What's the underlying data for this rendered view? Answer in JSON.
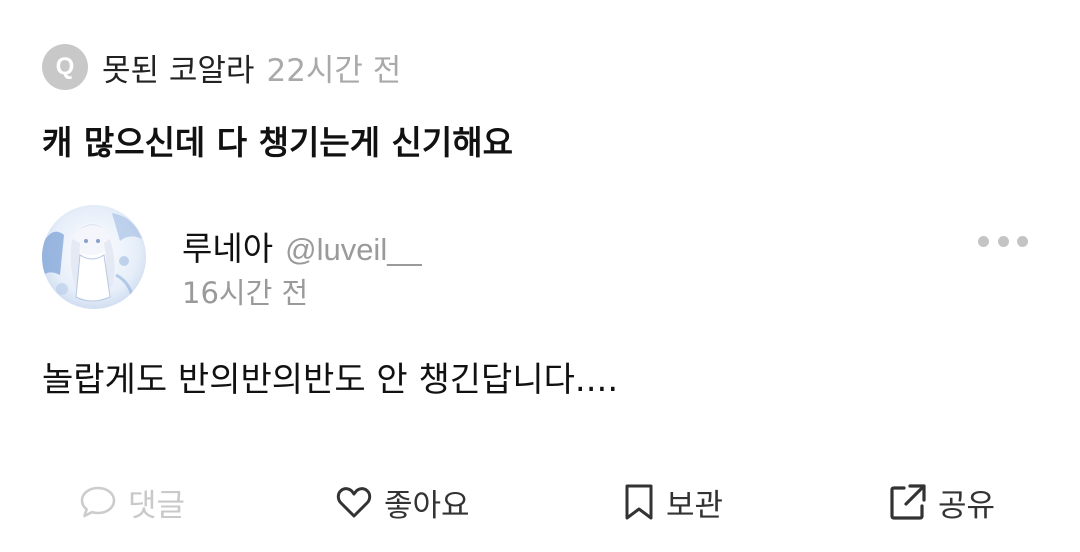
{
  "question": {
    "badge_letter": "Q",
    "asker": "못된 코알라",
    "time": "22시간 전",
    "text": "캐 많으신데 다 챙기는게 신기해요"
  },
  "answer": {
    "name": "루네아",
    "handle": "@luveil__",
    "time": "16시간 전",
    "text": "놀랍게도 반의반의반도 안 챙긴답니다...."
  },
  "actions": {
    "comment": "댓글",
    "like": "좋아요",
    "save": "보관",
    "share": "공유"
  },
  "icons": {
    "more": "more-horizontal-icon",
    "comment": "speech-bubble-icon",
    "like": "heart-icon",
    "save": "bookmark-icon",
    "share": "share-external-icon"
  },
  "colors": {
    "badge": "#c8c8c8",
    "muted_text": "#9a9a9a",
    "disabled_text": "#c9c9c9",
    "icon": "#333333"
  }
}
